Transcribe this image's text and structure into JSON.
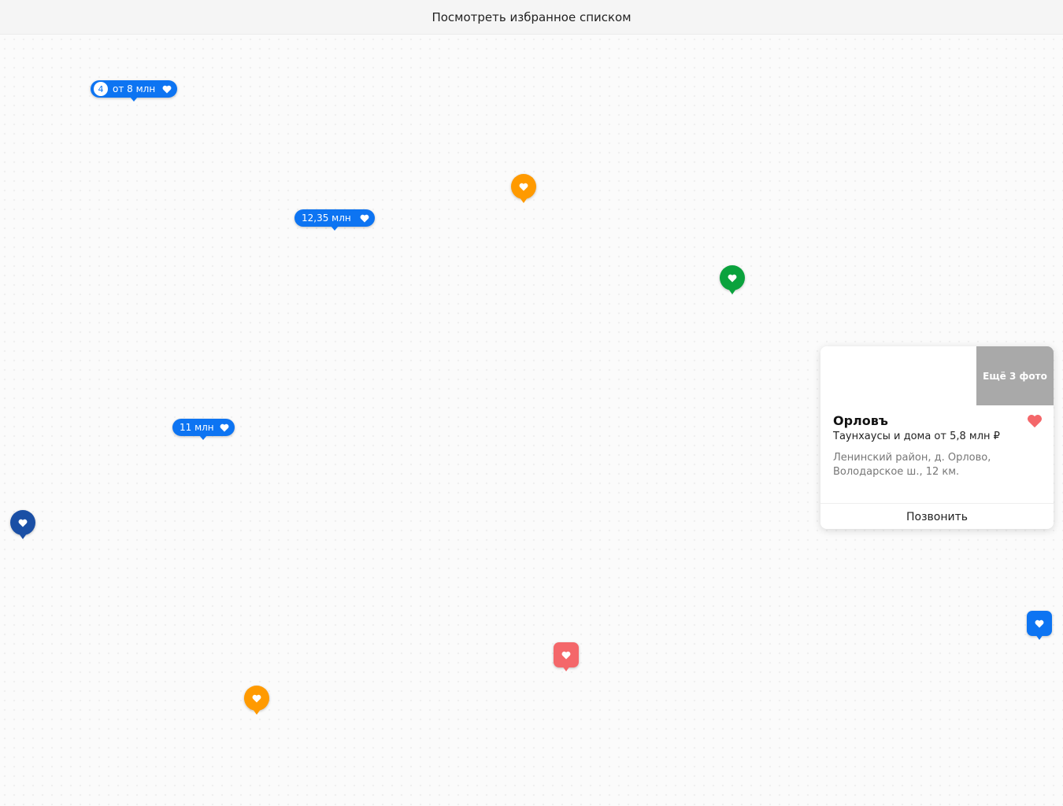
{
  "topbar": {
    "label": "Посмотреть избранное списком"
  },
  "colors": {
    "blue": "#0d74f2",
    "orange": "#ff9a00",
    "green": "#0aa23d",
    "navy": "#1a4fa5",
    "red": "#f4676a",
    "photo_gray": "#a9a9a9"
  },
  "markers": {
    "cluster": {
      "count": "4",
      "price": "от 8 млн",
      "icon": "heart-icon"
    },
    "price_1": {
      "price": "12,35 млн",
      "icon": "heart-icon"
    },
    "price_2": {
      "price": "11 млн",
      "icon": "heart-icon"
    },
    "pins": [
      {
        "color": "orange",
        "icon": "heart-icon"
      },
      {
        "color": "green",
        "icon": "heart-icon"
      },
      {
        "color": "navy",
        "icon": "heart-icon"
      },
      {
        "color": "red",
        "icon": "heart-icon"
      },
      {
        "color": "orange",
        "icon": "heart-icon"
      },
      {
        "color": "blue",
        "icon": "heart-icon"
      }
    ]
  },
  "card": {
    "more_photos": "Ещё 3 фото",
    "title": "Орловъ",
    "subtitle": "Таунхаусы и дома от 5,8 млн ₽",
    "address": "Ленинский район, д. Орлово, Володарское ш., 12 км.",
    "call_button": "Позвонить",
    "favorite_icon": "heart-icon"
  }
}
